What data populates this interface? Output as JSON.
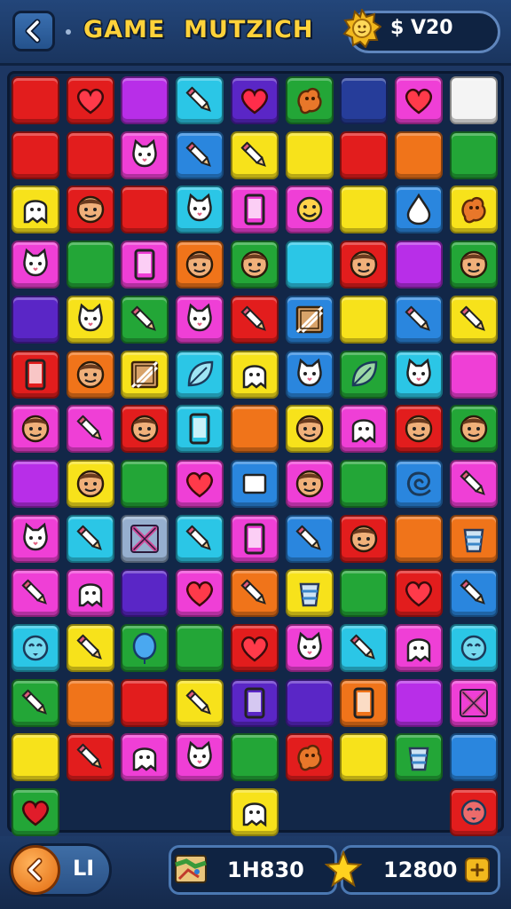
{
  "header": {
    "title": "GAME  MUTZICH",
    "currency": "$ V20",
    "back_icon": "chevron-left-icon",
    "badge_icon": "sun-coin-badge-icon"
  },
  "board": {
    "columns": 9,
    "colors": {
      "R": "#e21d1d",
      "O": "#f0741a",
      "Y": "#f7e21b",
      "G": "#23a637",
      "C": "#2bc6e6",
      "B": "#2a86de",
      "P": "#b82ee8",
      "M": "#ef3fd6",
      "N": "#5a26c6",
      "W": "#f4f4f4",
      "D": "#263d9a",
      "S": "#96afcf"
    },
    "rows": [
      [
        "R:none",
        "R:heart",
        "P:none",
        "C:pencil",
        "N:heart",
        "G:blob",
        "D:none",
        "M:heart",
        "W:none"
      ],
      [
        "R:none",
        "R:none",
        "M:cat",
        "B:pencil",
        "Y:pencil",
        "Y:none",
        "R:none",
        "O:none",
        "G:none"
      ],
      [
        "Y:ghost",
        "R:face",
        "R:none",
        "C:cat",
        "M:phone",
        "M:smile",
        "Y:none",
        "B:drop",
        "Y:blob"
      ],
      [
        "M:cat",
        "G:none",
        "M:phone",
        "O:face",
        "G:face",
        "C:none",
        "R:face",
        "P:none",
        "G:face"
      ],
      [
        "N:none",
        "Y:cat",
        "G:pencil",
        "M:cat",
        "R:pencil",
        "B:box",
        "Y:none",
        "B:pencil",
        "Y:pencil"
      ],
      [
        "R:phone",
        "O:face",
        "Y:box",
        "C:leaf",
        "Y:ghost",
        "B:cat",
        "G:leaf",
        "C:cat",
        "M:none"
      ],
      [
        "M:face",
        "M:pencil",
        "R:face",
        "C:phone",
        "O:none",
        "Y:face",
        "M:ghost",
        "R:face",
        "G:face"
      ],
      [
        "P:none",
        "Y:face",
        "G:none",
        "M:heart",
        "B:square",
        "M:face",
        "G:none",
        "B:swirl",
        "M:pencil"
      ],
      [
        "M:cat",
        "C:pencil",
        "S:cross",
        "C:pencil",
        "M:phone",
        "B:pencil",
        "R:face",
        "O:none",
        "O:cup"
      ],
      [
        "M:pencil",
        "M:ghost",
        "N:none",
        "M:heart",
        "O:pencil",
        "Y:cup",
        "G:none",
        "R:heart",
        "B:pencil"
      ],
      [
        "C:bird",
        "Y:pencil",
        "G:balloon",
        "G:none",
        "R:heart",
        "M:cat",
        "C:pencil",
        "M:ghost",
        "C:bird"
      ],
      [
        "G:pencil",
        "O:none",
        "R:none",
        "Y:pencil",
        "N:phone",
        "N:none",
        "O:phone",
        "P:none",
        "M:cross"
      ],
      [
        "Y:none",
        "R:pencil",
        "M:ghost",
        "M:cat",
        "G:none",
        "R:blob",
        "Y:none",
        "G:cup",
        "B:none"
      ],
      [
        "G:heart",
        "",
        "",
        "",
        "Y:ghost",
        "",
        "",
        "",
        "R:bird"
      ]
    ]
  },
  "footer": {
    "back_icon": "chevron-left-icon",
    "label": "LI",
    "stat1_icon": "map-icon",
    "stat1_value": "1H830",
    "stat2_icon": "star-icon",
    "stat2_value": "12800",
    "stat2_badge_icon": "plus-coin-icon"
  }
}
